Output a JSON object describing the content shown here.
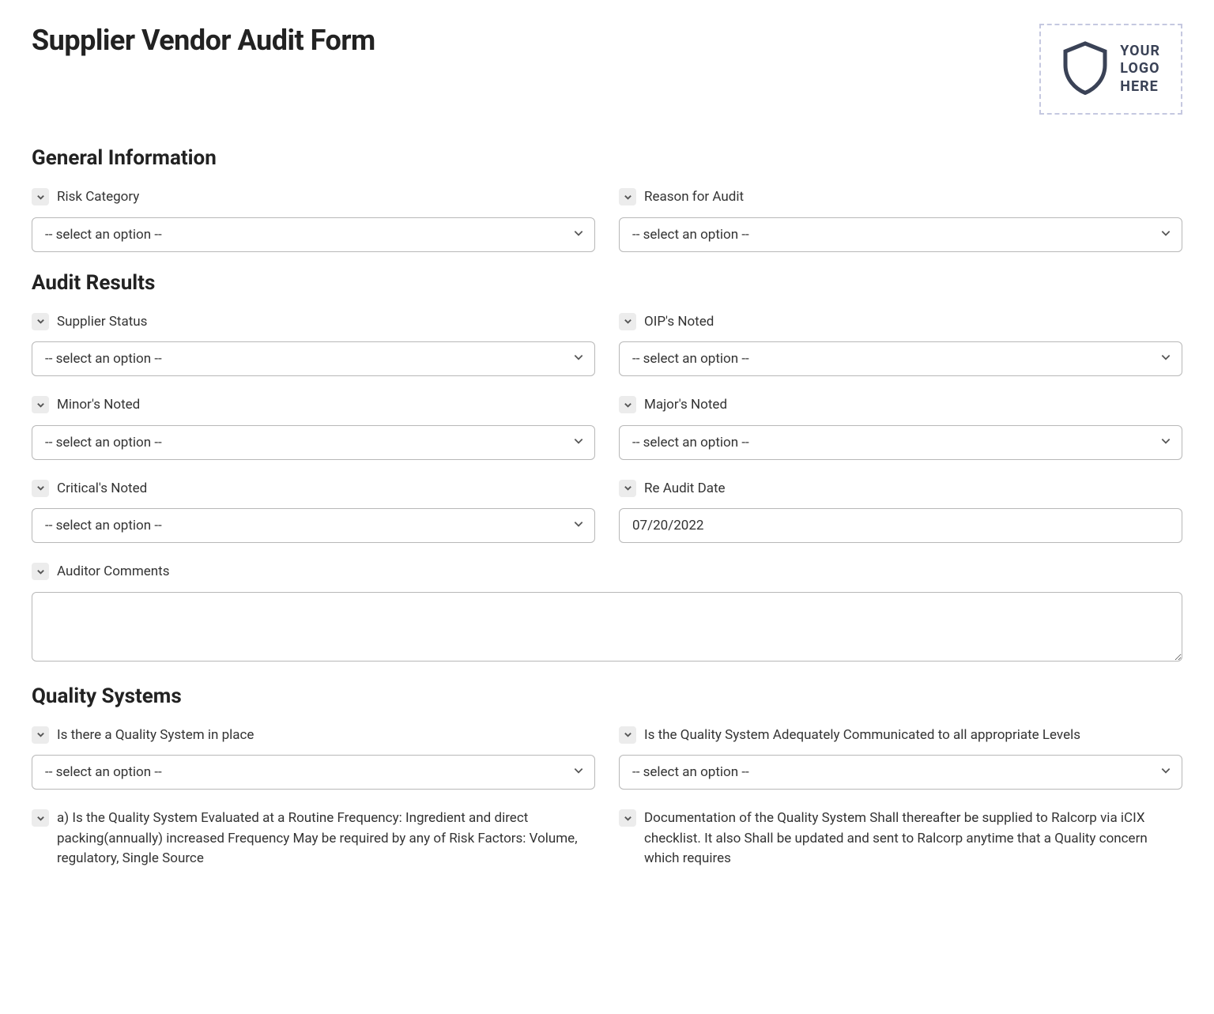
{
  "title": "Supplier Vendor Audit Form",
  "logo": {
    "line1": "YOUR",
    "line2": "LOGO",
    "line3": "HERE"
  },
  "select_placeholder": "-- select an option --",
  "sections": {
    "general": {
      "heading": "General Information",
      "fields": {
        "risk_category": "Risk Category",
        "reason_for_audit": "Reason for Audit"
      }
    },
    "audit_results": {
      "heading": "Audit Results",
      "fields": {
        "supplier_status": "Supplier Status",
        "oips_noted": "OIP's Noted",
        "minors_noted": "Minor's Noted",
        "majors_noted": "Major's Noted",
        "criticals_noted": "Critical's Noted",
        "re_audit_date": "Re Audit Date",
        "re_audit_date_value": "07/20/2022",
        "auditor_comments": "Auditor Comments",
        "auditor_comments_value": ""
      }
    },
    "quality_systems": {
      "heading": "Quality Systems",
      "fields": {
        "qs_in_place": "Is there a Quality System in place",
        "qs_communicated": "Is the Quality System Adequately Communicated to all appropriate Levels",
        "qs_evaluated": "a) Is the Quality System Evaluated at a Routine Frequency: Ingredient and direct packing(annually) increased Frequency May be required by any of Risk Factors: Volume, regulatory, Single Source",
        "qs_documentation": "Documentation of the Quality System Shall thereafter be supplied to Ralcorp via iCIX checklist. It also Shall be updated and sent to Ralcorp anytime that a Quality concern which requires"
      }
    }
  }
}
